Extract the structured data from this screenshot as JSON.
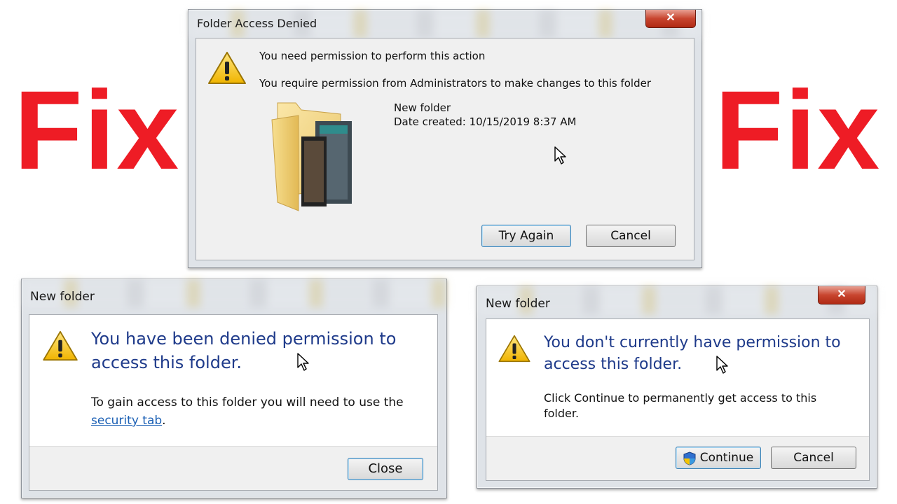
{
  "overlay": {
    "left_text": "Fix",
    "right_text": "Fix",
    "color": "#ee1c25"
  },
  "dialog1": {
    "title": "Folder Access Denied",
    "close_glyph": "✕",
    "message_line1": "You need permission to perform this action",
    "message_line2": "You require permission from Administrators to make changes to this folder",
    "item_name": "New folder",
    "item_date": "Date created: 10/15/2019 8:37 AM",
    "try_again_label": "Try Again",
    "cancel_label": "Cancel",
    "icon": "warning-icon",
    "folder_icon": "folder-icon"
  },
  "dialog2": {
    "title": "New folder",
    "heading": "You have been denied permission to access this folder.",
    "body_prefix": "To gain access to this folder you will need to use the",
    "link_text": "security tab",
    "body_suffix": ".",
    "close_label": "Close",
    "icon": "warning-icon"
  },
  "dialog3": {
    "title": "New folder",
    "close_glyph": "✕",
    "heading": "You don't currently have permission to access this folder.",
    "body": "Click Continue to permanently get access to this folder.",
    "continue_label": "Continue",
    "cancel_label": "Cancel",
    "icon": "warning-icon",
    "shield_icon": "uac-shield-icon"
  },
  "colors": {
    "heading_blue": "#1e3a8a",
    "link_blue": "#1a5fb4",
    "close_red": "#c8452f"
  }
}
